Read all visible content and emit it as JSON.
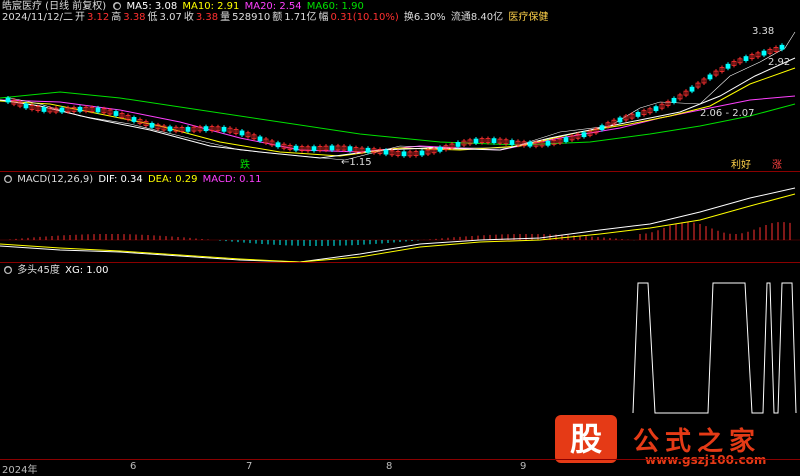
{
  "header": {
    "title": "皓宸医疗 (日线 前复权)",
    "ma5": "MA5: 3.08",
    "ma10": "MA10: 2.91",
    "ma20": "MA20: 2.54",
    "ma60": "MA60: 1.90",
    "date": "2024/11/12/二",
    "open_label": "开",
    "open": "3.12",
    "high_label": "高",
    "high": "3.38",
    "low_label": "低",
    "low": "3.07",
    "close_label": "收",
    "close": "3.38",
    "vol_label": "量",
    "vol": "528910",
    "amt_label": "额",
    "amt": "1.71亿",
    "chg_label": "幅",
    "chg": "0.31(10.10%)",
    "turnover": "换6.30%",
    "float": "流通8.40亿",
    "sector": "医疗保健"
  },
  "price_annotations": {
    "high_mark": "3.38",
    "mid_mark": "2.92",
    "ma_mark": "2.06 - 2.07",
    "low_mark": "1.15",
    "tag_die": "跌",
    "tag_lihao": "利好",
    "tag_zhang": "涨"
  },
  "macd": {
    "title": "MACD(12,26,9)",
    "dif": "DIF: 0.34",
    "dea": "DEA: 0.29",
    "macd": "MACD: 0.11"
  },
  "xg": {
    "title": "多头45度",
    "value": "XG: 1.00"
  },
  "axis": {
    "labels": [
      "2024年",
      "6",
      "7",
      "8",
      "9"
    ]
  },
  "watermark": {
    "logo_char": "股",
    "name": "公式之家",
    "url": "www.gszj100.com"
  },
  "colors": {
    "ma5": "#ffffff",
    "ma10": "#ffff00",
    "ma20": "#ff40ff",
    "ma60": "#00e000",
    "up": "#ff3030",
    "down": "#00ffff",
    "grid": "#8a0000"
  }
}
